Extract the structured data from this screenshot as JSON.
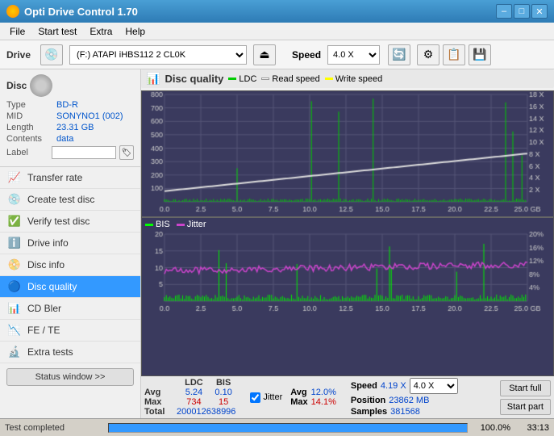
{
  "app": {
    "title": "Opti Drive Control 1.70",
    "icon": "cd-icon"
  },
  "titlebar": {
    "minimize": "–",
    "restore": "□",
    "close": "✕"
  },
  "menu": {
    "items": [
      "File",
      "Start test",
      "Extra",
      "Help"
    ]
  },
  "drive": {
    "label": "Drive",
    "select_value": "(F:) ATAPI iHBS112  2 CL0K",
    "speed_label": "Speed",
    "speed_value": "4.0 X"
  },
  "disc": {
    "section": "Disc",
    "type_label": "Type",
    "type_value": "BD-R",
    "mid_label": "MID",
    "mid_value": "SONYNO1 (002)",
    "length_label": "Length",
    "length_value": "23.31 GB",
    "contents_label": "Contents",
    "contents_value": "data",
    "label_label": "Label",
    "label_value": ""
  },
  "nav": {
    "items": [
      {
        "id": "transfer-rate",
        "label": "Transfer rate",
        "icon": "📈"
      },
      {
        "id": "create-test-disc",
        "label": "Create test disc",
        "icon": "💿"
      },
      {
        "id": "verify-test-disc",
        "label": "Verify test disc",
        "icon": "✅"
      },
      {
        "id": "drive-info",
        "label": "Drive info",
        "icon": "ℹ️"
      },
      {
        "id": "disc-info",
        "label": "Disc info",
        "icon": "📀"
      },
      {
        "id": "disc-quality",
        "label": "Disc quality",
        "icon": "🔵",
        "active": true
      },
      {
        "id": "cd-bler",
        "label": "CD Bler",
        "icon": "📊"
      },
      {
        "id": "fe-te",
        "label": "FE / TE",
        "icon": "📉"
      },
      {
        "id": "extra-tests",
        "label": "Extra tests",
        "icon": "🔬"
      }
    ],
    "status_btn": "Status window >>"
  },
  "chart": {
    "title": "Disc quality",
    "upper_legend": [
      "LDC",
      "Read speed",
      "Write speed"
    ],
    "lower_legend": [
      "BIS",
      "Jitter"
    ],
    "upper_y_max": 800,
    "upper_y_labels": [
      "800",
      "700",
      "600",
      "500",
      "400",
      "300",
      "200",
      "100"
    ],
    "upper_y_right": [
      "18 X",
      "16 X",
      "14 X",
      "12 X",
      "10 X",
      "8 X",
      "6 X",
      "4 X",
      "2 X"
    ],
    "lower_y_max": 20,
    "lower_y_labels": [
      "20",
      "15",
      "10",
      "5"
    ],
    "lower_y_right": [
      "20%",
      "16%",
      "12%",
      "8%",
      "4%"
    ],
    "x_labels": [
      "0.0",
      "2.5",
      "5.0",
      "7.5",
      "10.0",
      "12.5",
      "15.0",
      "17.5",
      "20.0",
      "22.5",
      "25.0 GB"
    ]
  },
  "stats": {
    "headers": [
      "LDC",
      "BIS"
    ],
    "avg_label": "Avg",
    "avg_ldc": "5.24",
    "avg_bis": "0.10",
    "max_label": "Max",
    "max_ldc": "734",
    "max_bis": "15",
    "total_label": "Total",
    "total_ldc": "2000126",
    "total_bis": "38996",
    "jitter_label": "Jitter",
    "jitter_avg": "12.0%",
    "jitter_max": "14.1%",
    "speed_label": "Speed",
    "speed_value": "4.19 X",
    "speed_select": "4.0 X",
    "position_label": "Position",
    "position_value": "23862 MB",
    "samples_label": "Samples",
    "samples_value": "381568",
    "btn_start_full": "Start full",
    "btn_start_part": "Start part"
  },
  "status_bar": {
    "text": "Test completed",
    "progress": 100,
    "percent": "100.0%",
    "time": "33:13"
  },
  "colors": {
    "ldc": "#00cc00",
    "read_speed": "#ffffff",
    "write_speed": "#ffff00",
    "bis": "#00ff00",
    "jitter": "#cc44cc",
    "chart_bg": "#3a3a5e",
    "grid": "#5a5a7a",
    "accent": "#3399ff"
  }
}
